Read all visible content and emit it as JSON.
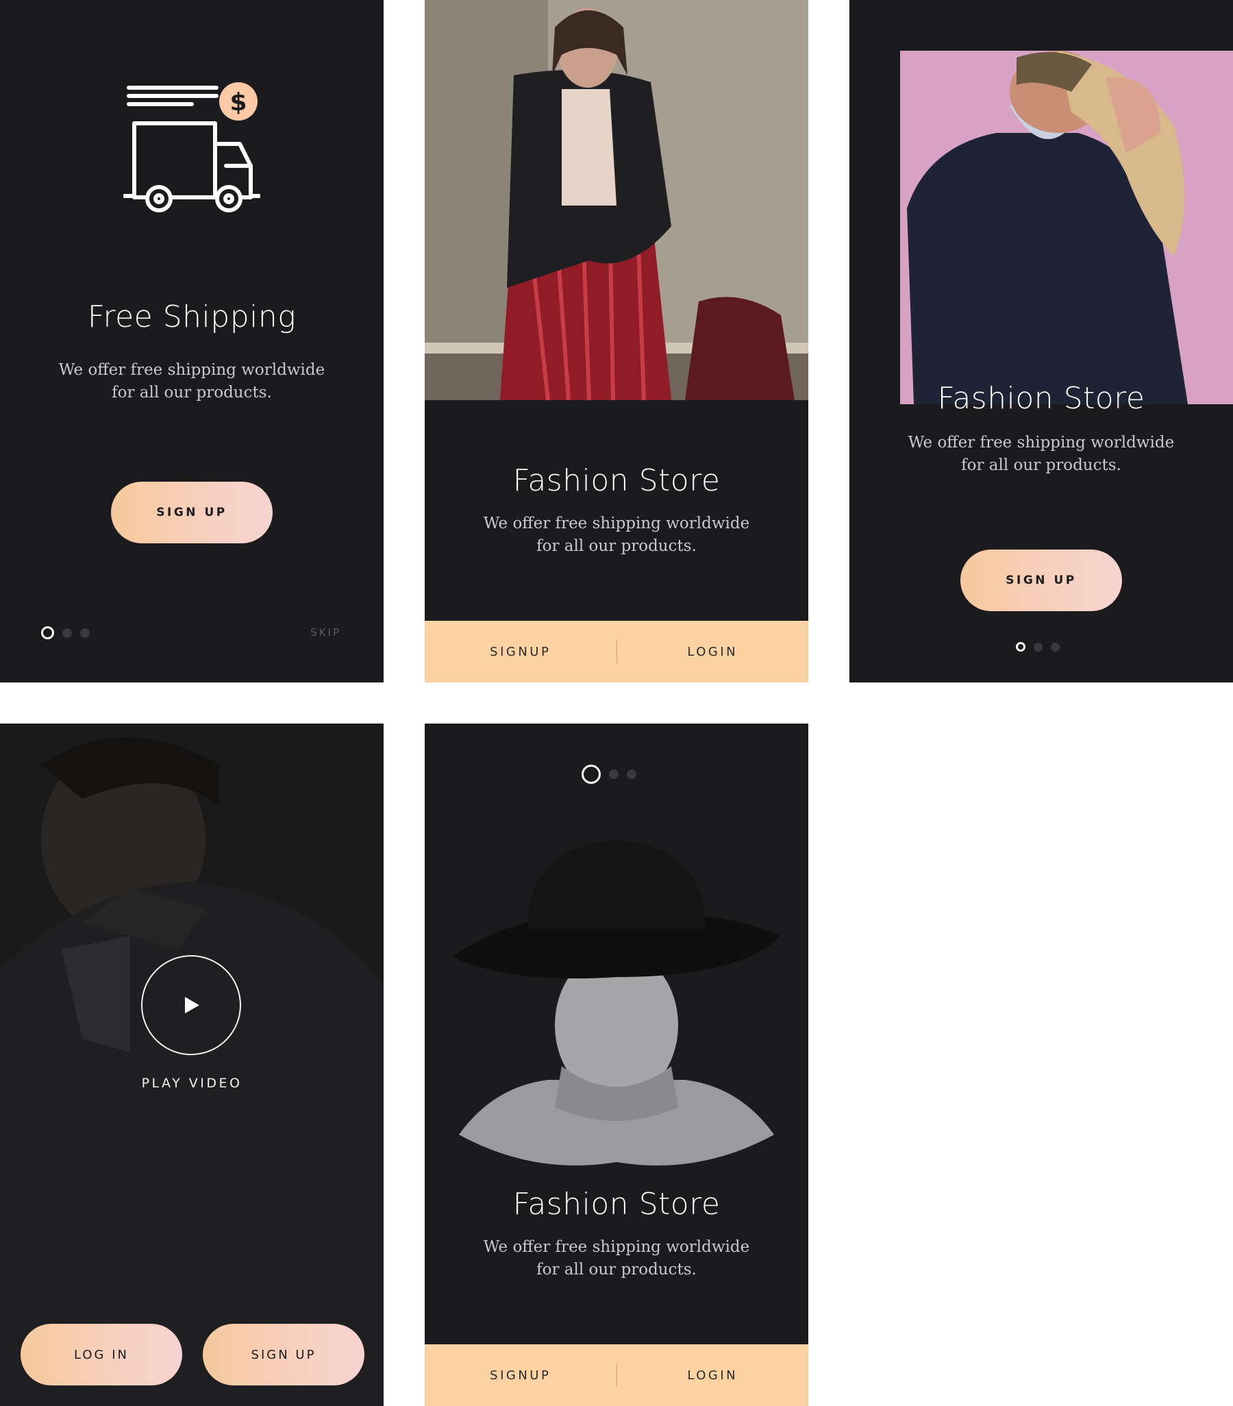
{
  "screens": {
    "free_shipping": {
      "title": "Free Shipping",
      "desc_line1": "We offer free shipping worldwide",
      "desc_line2": "for all our products.",
      "signup_label": "SIGN UP",
      "skip_label": "SKIP",
      "icon": "delivery-truck-dollar-icon",
      "pagination": {
        "current": 1,
        "total": 3
      }
    },
    "fashion_photo_top": {
      "title": "Fashion Store",
      "desc_line1": "We offer free shipping worldwide",
      "desc_line2": "for all our products.",
      "signup_tab": "SIGNUP",
      "login_tab": "LOGIN"
    },
    "fashion_pink": {
      "title": "Fashion Store",
      "desc_line1": "We offer free shipping worldwide",
      "desc_line2": "for all our products.",
      "signup_label": "SIGN UP",
      "pagination": {
        "current": 1,
        "total": 3
      }
    },
    "video": {
      "play_label": "PLAY VIDEO",
      "login_label": "LOG IN",
      "signup_label": "SIGN UP"
    },
    "fashion_hat": {
      "title": "Fashion Store",
      "desc_line1": "We offer free shipping worldwide",
      "desc_line2": "for all our products.",
      "signup_tab": "SIGNUP",
      "login_tab": "LOGIN",
      "pagination": {
        "current": 1,
        "total": 3
      }
    }
  },
  "colors": {
    "screen_bg": "#1b1b1d",
    "accent_peach": "#fbd3a3",
    "gradient_start": "#f6c99b",
    "gradient_end": "#f6d3d0",
    "text_light": "#ffffff",
    "text_muted": "#c9c9cc"
  }
}
